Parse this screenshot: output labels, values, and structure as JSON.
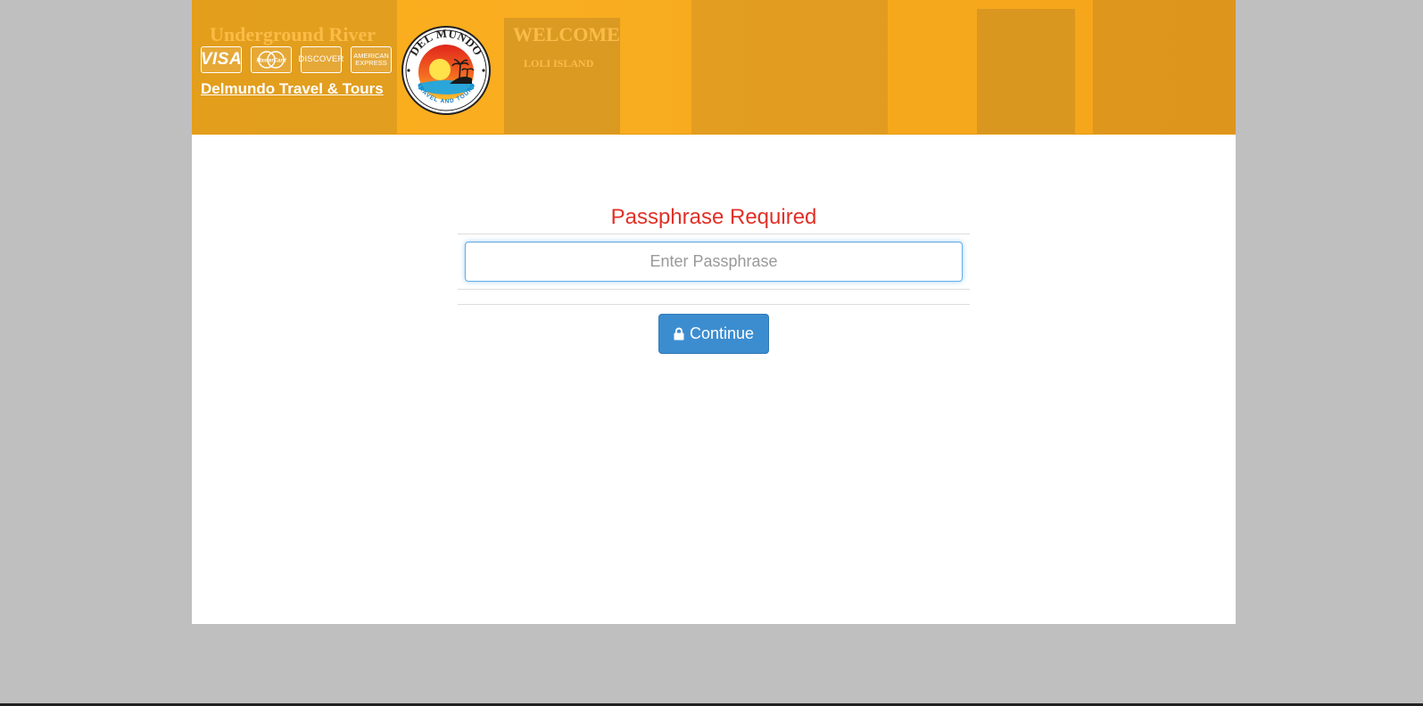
{
  "colors": {
    "background": "#bfbfbf",
    "banner": "#fbae1c",
    "heading": "#e03128",
    "button": "#3c8dd0",
    "input_focus_border": "#66afe9"
  },
  "header": {
    "cards": [
      {
        "name": "visa",
        "label": "VISA"
      },
      {
        "name": "mastercard",
        "label": "MasterCard"
      },
      {
        "name": "discover",
        "label": "DISCOVER"
      },
      {
        "name": "amex",
        "label": "AMERICAN EXPRESS"
      }
    ],
    "brand_link": "Delmundo Travel & Tours",
    "logo": {
      "top_text": "DEL MUNDO",
      "bottom_text": "TRAVEL AND TOURS"
    },
    "banner_photo_text": [
      "Underground River",
      "WELCOME",
      "LOLI ISLAND"
    ]
  },
  "form": {
    "heading": "Passphrase Required",
    "passphrase_placeholder": "Enter Passphrase",
    "passphrase_value": "",
    "submit_label": "Continue",
    "submit_icon": "lock-icon"
  }
}
